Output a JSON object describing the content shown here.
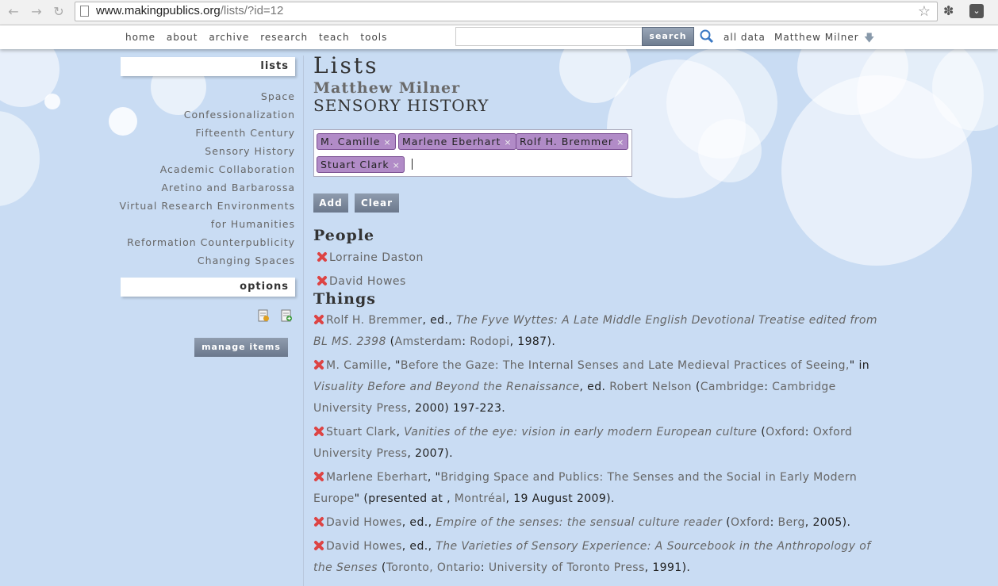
{
  "browser": {
    "url_host": "www.makingpublics.org",
    "url_path": "/lists/?id=12"
  },
  "nav": {
    "menu": [
      "home",
      "about",
      "archive",
      "research",
      "teach",
      "tools"
    ],
    "search_label": "search",
    "all_data": "all data",
    "user": "Matthew Milner"
  },
  "sidebar": {
    "lists_title": "lists",
    "items": [
      "Space",
      "Confessionalization",
      "Fifteenth Century",
      "Sensory History",
      "Academic Collaboration",
      "Aretino and Barbarossa",
      "Virtual Research Environments",
      "for Humanities",
      "Reformation Counterpublicity",
      "Changing Spaces"
    ],
    "options_title": "options",
    "manage_label": "manage items"
  },
  "main": {
    "title": "Lists",
    "owner": "Matthew Milner",
    "list_name": "SENSORY HISTORY",
    "tags": [
      "M. Camille",
      "Marlene Eberhart",
      "Rolf H. Bremmer",
      "Stuart Clark"
    ],
    "add_label": "Add",
    "clear_label": "Clear",
    "people_title": "People",
    "people": [
      "Lorraine Daston",
      "David Howes"
    ],
    "things_title": "Things",
    "things": [
      {
        "lines": [
          [
            {
              "t": "Rolf H. Bremmer"
            },
            {
              "t": ", ed., ",
              "dk": true
            },
            {
              "t": "The Fyve Wyttes: A Late Middle English Devotional Treatise edited from",
              "i": true
            }
          ],
          [
            {
              "t": "BL MS. 2398",
              "i": true
            },
            {
              "t": " (",
              "dk": true
            },
            {
              "t": "Amsterdam"
            },
            {
              "t": ": ",
              "dk": true
            },
            {
              "t": "Rodopi"
            },
            {
              "t": ", 1987).",
              "dk": true
            }
          ]
        ]
      },
      {
        "lines": [
          [
            {
              "t": "M. Camille"
            },
            {
              "t": ", \"",
              "dk": true
            },
            {
              "t": "Before the Gaze: The Internal Senses and Late Medieval Practices of Seeing,"
            },
            {
              "t": "\" in",
              "dk": true
            }
          ],
          [
            {
              "t": "Visuality Before and Beyond the Renaissance",
              "i": true
            },
            {
              "t": ", ed. ",
              "dk": true
            },
            {
              "t": "Robert Nelson"
            },
            {
              "t": " (",
              "dk": true
            },
            {
              "t": "Cambridge"
            },
            {
              "t": ": ",
              "dk": true
            },
            {
              "t": "Cambridge"
            }
          ],
          [
            {
              "t": "University Press"
            },
            {
              "t": ", 2000) 197-223.",
              "dk": true
            }
          ]
        ]
      },
      {
        "lines": [
          [
            {
              "t": "Stuart Clark"
            },
            {
              "t": ", ",
              "dk": true
            },
            {
              "t": "Vanities of the eye: vision in early modern European culture",
              "i": true
            },
            {
              "t": " (",
              "dk": true
            },
            {
              "t": "Oxford"
            },
            {
              "t": ": ",
              "dk": true
            },
            {
              "t": "Oxford"
            }
          ],
          [
            {
              "t": "University Press"
            },
            {
              "t": ", 2007).",
              "dk": true
            }
          ]
        ]
      },
      {
        "lines": [
          [
            {
              "t": "Marlene Eberhart"
            },
            {
              "t": ", \"",
              "dk": true
            },
            {
              "t": "Bridging Space and Publics: The Senses and the Social in Early Modern"
            }
          ],
          [
            {
              "t": "Europe"
            },
            {
              "t": "\" (presented at , ",
              "dk": true
            },
            {
              "t": "Montréal"
            },
            {
              "t": ", 19 August 2009).",
              "dk": true
            }
          ]
        ]
      },
      {
        "lines": [
          [
            {
              "t": "David Howes"
            },
            {
              "t": ", ed., ",
              "dk": true
            },
            {
              "t": "Empire of the senses: the sensual culture reader",
              "i": true
            },
            {
              "t": " (",
              "dk": true
            },
            {
              "t": "Oxford"
            },
            {
              "t": ": ",
              "dk": true
            },
            {
              "t": "Berg"
            },
            {
              "t": ", 2005).",
              "dk": true
            }
          ]
        ]
      },
      {
        "lines": [
          [
            {
              "t": "David Howes"
            },
            {
              "t": ", ed., ",
              "dk": true
            },
            {
              "t": "The Varieties of Sensory Experience: A Sourcebook in the Anthropology of",
              "i": true
            }
          ],
          [
            {
              "t": "the Senses",
              "i": true
            },
            {
              "t": " (",
              "dk": true
            },
            {
              "t": "Toronto, Ontario"
            },
            {
              "t": ": ",
              "dk": true
            },
            {
              "t": "University of Toronto Press"
            },
            {
              "t": ", 1991).",
              "dk": true
            }
          ]
        ]
      }
    ]
  }
}
